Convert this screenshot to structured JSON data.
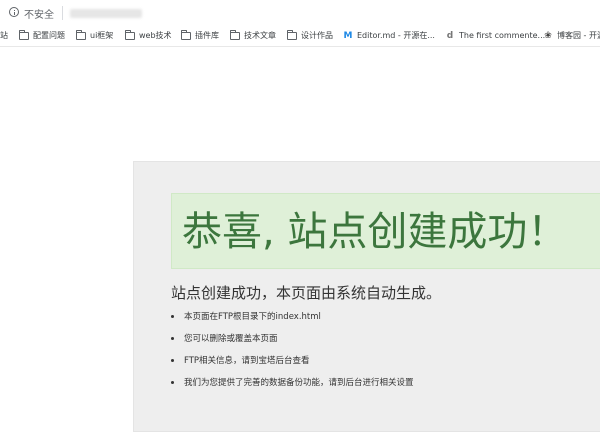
{
  "address_bar": {
    "security_label": "不安全"
  },
  "bookmarks": [
    {
      "icon": "folder-icon",
      "label": "站"
    },
    {
      "icon": "folder-icon",
      "label": "配置问题"
    },
    {
      "icon": "folder-icon",
      "label": "ui框架"
    },
    {
      "icon": "folder-icon",
      "label": "web技术"
    },
    {
      "icon": "folder-icon",
      "label": "插件库"
    },
    {
      "icon": "folder-icon",
      "label": "技术文章"
    },
    {
      "icon": "folder-icon",
      "label": "设计作品"
    },
    {
      "icon": "editor-md-icon",
      "label": "Editor.md - 开源在..."
    },
    {
      "icon": "comment-site-icon",
      "label": "The first commente..."
    },
    {
      "icon": "cnblogs-icon",
      "label": "博客园 - 开源"
    }
  ],
  "page": {
    "banner_title": "恭喜, 站点创建成功！",
    "sub_heading": "站点创建成功，本页面由系统自动生成。",
    "bullets": [
      "本页面在FTP根目录下的index.html",
      "您可以删除或覆盖本页面",
      "FTP相关信息，请到宝塔后台查看",
      "我们为您提供了完善的数据备份功能，请到后台进行相关设置"
    ]
  },
  "colors": {
    "banner_bg": "#dff0d8",
    "banner_text": "#3c763d",
    "card_bg": "#eeeeee"
  }
}
